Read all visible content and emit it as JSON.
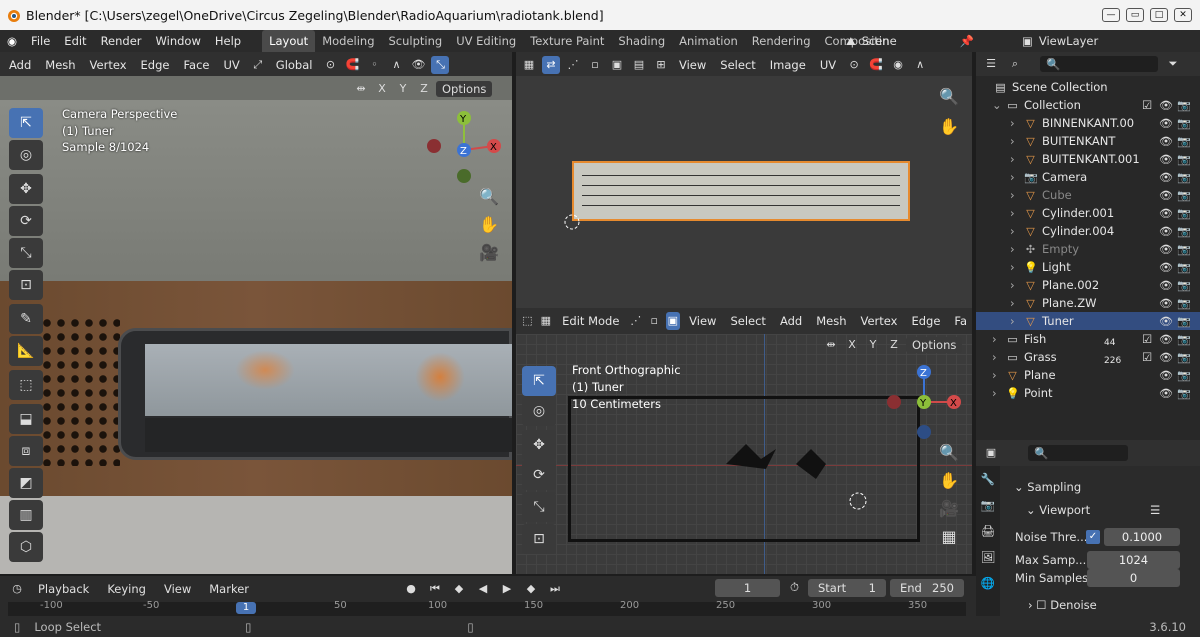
{
  "window": {
    "title": "Blender* [C:\\Users\\zegel\\OneDrive\\Circus Zegeling\\Blender\\RadioAquarium\\radiotank.blend]"
  },
  "menu": [
    "File",
    "Edit",
    "Render",
    "Window",
    "Help"
  ],
  "workspaces": [
    "Layout",
    "Modeling",
    "Sculpting",
    "UV Editing",
    "Texture Paint",
    "Shading",
    "Animation",
    "Rendering",
    "Compositin"
  ],
  "active_workspace": "Layout",
  "scene": "Scene",
  "view_layer": "ViewLayer",
  "left_header": {
    "items": [
      "Add",
      "Mesh",
      "Vertex",
      "Edge",
      "Face",
      "UV"
    ],
    "transform": "Global"
  },
  "left_viewport": {
    "hud": [
      "Camera Perspective",
      "(1) Tuner",
      "Sample 8/1024"
    ],
    "axes": [
      "X",
      "Y",
      "Z"
    ],
    "options": "Options"
  },
  "uv_header": {
    "items": [
      "View",
      "Select",
      "Image",
      "UV"
    ]
  },
  "edit_header": {
    "mode": "Edit Mode",
    "items": [
      "View",
      "Select",
      "Add",
      "Mesh",
      "Vertex",
      "Edge",
      "Fa"
    ]
  },
  "right_viewport": {
    "hud": [
      "Front Orthographic",
      "(1) Tuner",
      "10 Centimeters"
    ],
    "axes": [
      "X",
      "Y",
      "Z"
    ],
    "options": "Options"
  },
  "gizmo_labels": {
    "x": "X",
    "y": "Y",
    "z": "Z"
  },
  "outliner": {
    "root": "Scene Collection",
    "rows": [
      {
        "label": "Collection",
        "icon": "collection-icon"
      },
      {
        "label": "BINNENKANT.00",
        "icon": "mesh-icon"
      },
      {
        "label": "BUITENKANT",
        "icon": "mesh-icon"
      },
      {
        "label": "BUITENKANT.001",
        "icon": "mesh-icon"
      },
      {
        "label": "Camera",
        "icon": "camera-icon"
      },
      {
        "label": "Cube",
        "icon": "mesh-icon"
      },
      {
        "label": "Cylinder.001",
        "icon": "mesh-icon"
      },
      {
        "label": "Cylinder.004",
        "icon": "mesh-icon"
      },
      {
        "label": "Empty",
        "icon": "empty-icon"
      },
      {
        "label": "Light",
        "icon": "light-icon"
      },
      {
        "label": "Plane.002",
        "icon": "mesh-icon"
      },
      {
        "label": "Plane.ZW",
        "icon": "mesh-icon"
      },
      {
        "label": "Tuner",
        "icon": "mesh-icon"
      },
      {
        "label": "Fish",
        "icon": "collection-icon",
        "badge": "44"
      },
      {
        "label": "Grass",
        "icon": "collection-icon",
        "badge": "226"
      },
      {
        "label": "Plane",
        "icon": "mesh-icon"
      },
      {
        "label": "Point",
        "icon": "light-icon"
      }
    ]
  },
  "properties": {
    "section": "Sampling",
    "subsection": "Viewport",
    "noise_label": "Noise Thre...",
    "noise_value": "0.1000",
    "max_label": "Max Samp...",
    "max_value": "1024",
    "min_label": "Min Samples",
    "min_value": "0",
    "denoise": "Denoise"
  },
  "timeline": {
    "items": [
      "Playback",
      "Keying",
      "View",
      "Marker"
    ],
    "current_frame": "1",
    "start_label": "Start",
    "start": "1",
    "end_label": "End",
    "end": "250",
    "ruler": [
      "-100",
      "-50",
      "1",
      "50",
      "100",
      "150",
      "200",
      "250",
      "300",
      "350"
    ]
  },
  "status": {
    "left": "Loop Select",
    "version": "3.6.10"
  }
}
